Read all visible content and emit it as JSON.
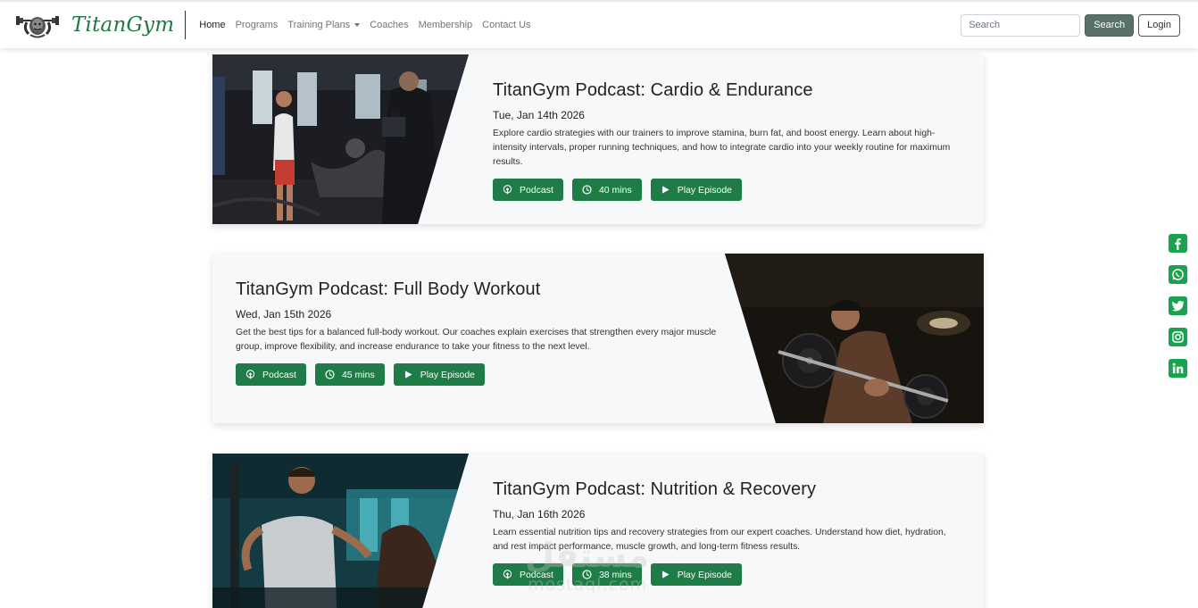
{
  "header": {
    "brand_name": "TitanGym",
    "nav": [
      {
        "label": "Home",
        "active": true
      },
      {
        "label": "Programs",
        "active": false
      },
      {
        "label": "Training Plans",
        "active": false,
        "dropdown": true
      },
      {
        "label": "Coaches",
        "active": false
      },
      {
        "label": "Membership",
        "active": false
      },
      {
        "label": "Contact Us",
        "active": false
      }
    ],
    "search_placeholder": "Search",
    "search_button": "Search",
    "login_button": "Login"
  },
  "episodes": [
    {
      "title": "TitanGym Podcast: Cardio & Endurance",
      "date": "Tue, Jan 14th 2026",
      "description": "Explore cardio strategies with our trainers to improve stamina, burn fat, and boost energy. Learn about high-intensity intervals, proper running techniques, and how to integrate cardio into your weekly routine for maximum results.",
      "type_label": "Podcast",
      "duration": "40 mins",
      "play_label": "Play Episode",
      "image_position": "left"
    },
    {
      "title": "TitanGym Podcast: Full Body Workout",
      "date": "Wed, Jan 15th 2026",
      "description": "Get the best tips for a balanced full-body workout. Our coaches explain exercises that strengthen every major muscle group, improve flexibility, and increase endurance to take your fitness to the next level.",
      "type_label": "Podcast",
      "duration": "45 mins",
      "play_label": "Play Episode",
      "image_position": "right"
    },
    {
      "title": "TitanGym Podcast: Nutrition & Recovery",
      "date": "Thu, Jan 16th 2026",
      "description": "Learn essential nutrition tips and recovery strategies from our expert coaches. Understand how diet, hydration, and rest impact performance, muscle growth, and long-term fitness results.",
      "type_label": "Podcast",
      "duration": "38 mins",
      "play_label": "Play Episode",
      "image_position": "left"
    }
  ],
  "social": [
    "facebook-icon",
    "whatsapp-icon",
    "twitter-icon",
    "instagram-icon",
    "linkedin-icon"
  ],
  "watermark": {
    "big": "مستقل",
    "small": "mostaql.com"
  },
  "colors": {
    "accent": "#1e7c46",
    "brand": "#1e7a45",
    "social": "#1aa34e",
    "search_button": "#5a706b"
  }
}
